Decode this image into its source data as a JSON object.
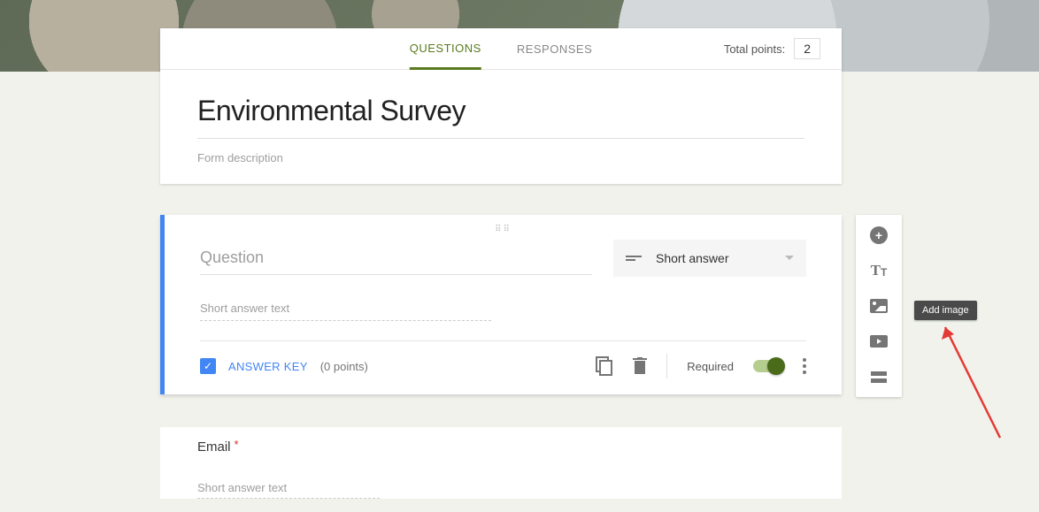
{
  "tabs": {
    "questions": "QUESTIONS",
    "responses": "RESPONSES"
  },
  "points": {
    "label": "Total points:",
    "value": "2"
  },
  "form": {
    "title": "Environmental Survey",
    "description_placeholder": "Form description"
  },
  "question": {
    "title_placeholder": "Question",
    "type_label": "Short answer",
    "short_answer_hint": "Short answer text",
    "answer_key_label": "ANSWER KEY",
    "answer_key_points": "(0 points)",
    "required_label": "Required"
  },
  "email": {
    "label": "Email",
    "required_mark": "*",
    "hint": "Short answer text"
  },
  "toolbar": {
    "add_question": "+",
    "tooltip_add_image": "Add image"
  }
}
